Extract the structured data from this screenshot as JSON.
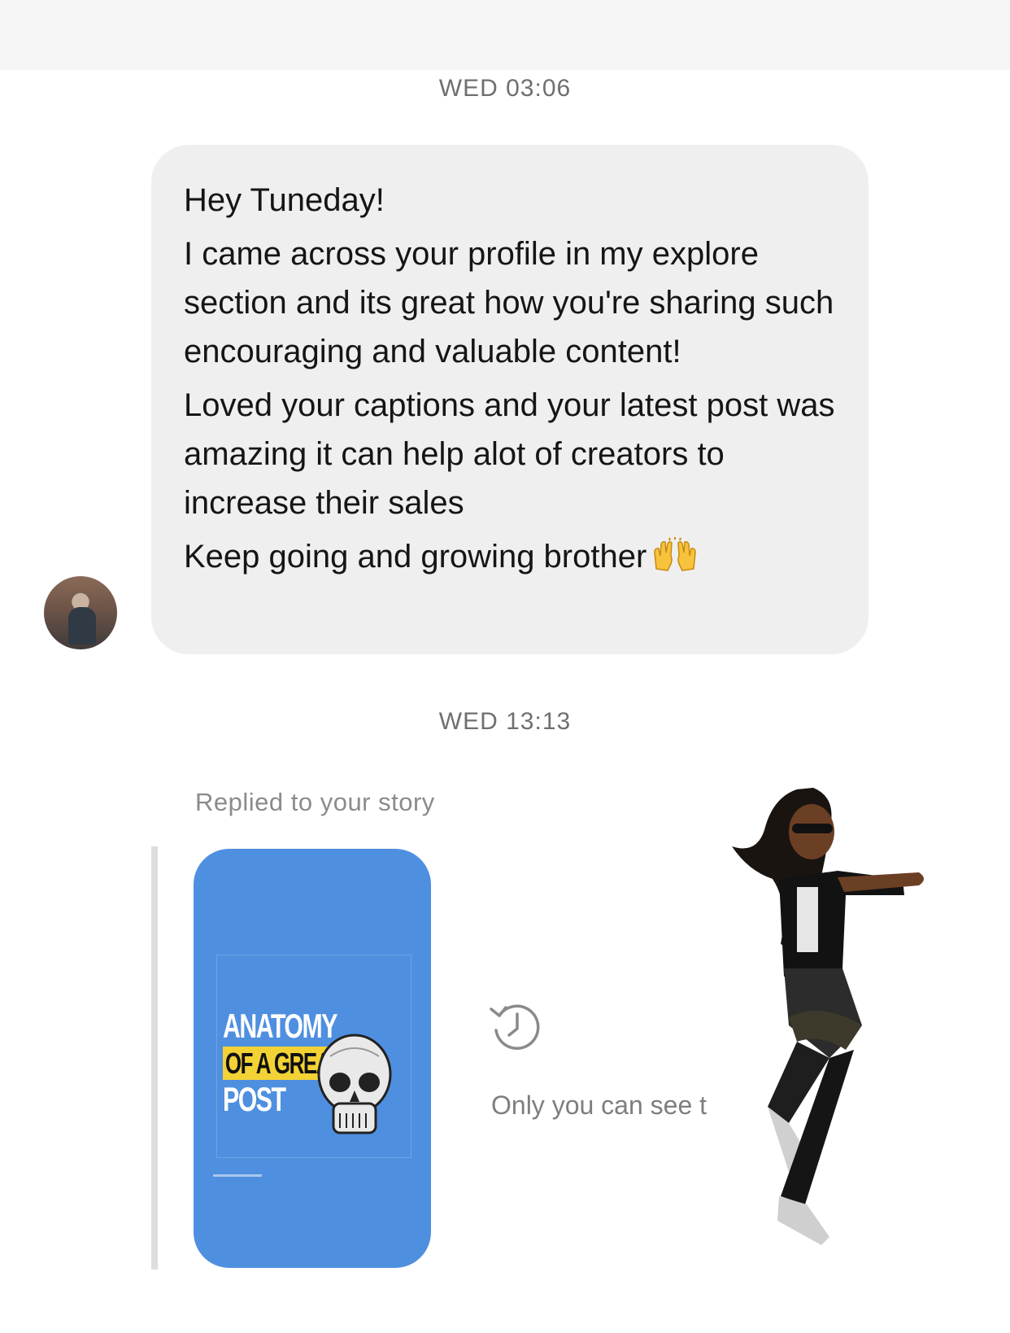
{
  "thread": {
    "timestamp_1": "WED 03:06",
    "message": {
      "lines": [
        "Hey Tuneday!",
        "I came across your profile in my explore section and its great how you're sharing such encouraging and valuable content!",
        "Loved your captions and your latest post was amazing it can help alot of creators to increase their sales",
        "Keep going and growing brother"
      ],
      "emoji": "raising-hands-emoji"
    },
    "timestamp_2": "WED 13:13",
    "story_reply": {
      "label": "Replied to your story",
      "story_title_line1": "ANATOMY",
      "story_title_line2": "OF A GREAT",
      "story_title_line3": "POST",
      "only_you_text": "Only you can see t"
    }
  },
  "colors": {
    "bubble": "#efefef",
    "story_bg": "#4f8fdf",
    "highlight": "#f3d235",
    "muted_text": "#7e7e7e"
  }
}
